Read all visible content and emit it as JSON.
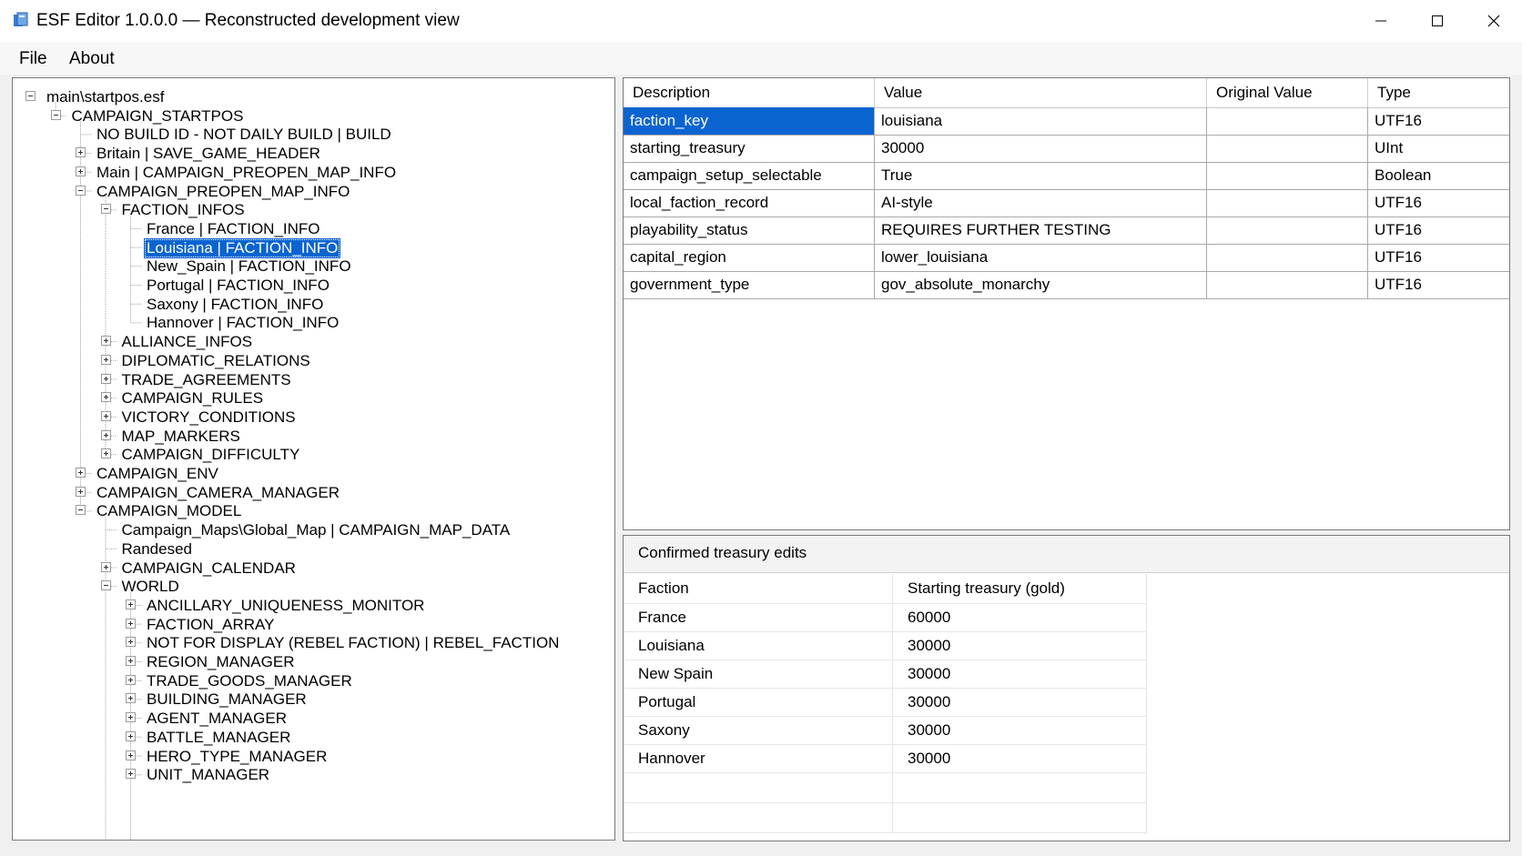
{
  "window": {
    "title": "ESF Editor 1.0.0.0 — Reconstructed development view",
    "controls": {
      "minimize": "minimize-icon",
      "maximize": "maximize-icon",
      "close": "close-icon"
    }
  },
  "menu": {
    "file": "File",
    "about": "About"
  },
  "tree": {
    "nodes": [
      {
        "label": "main\\startpos.esf",
        "level": 0,
        "state": "expanded"
      },
      {
        "label": "CAMPAIGN_STARTPOS",
        "level": 1,
        "state": "expanded"
      },
      {
        "label": "NO BUILD ID - NOT DAILY BUILD | BUILD",
        "level": 2,
        "state": "leaf"
      },
      {
        "label": "Britain | SAVE_GAME_HEADER",
        "level": 2,
        "state": "collapsed"
      },
      {
        "label": "Main | CAMPAIGN_PREOPEN_MAP_INFO",
        "level": 2,
        "state": "collapsed"
      },
      {
        "label": "CAMPAIGN_PREOPEN_MAP_INFO",
        "level": 2,
        "state": "expanded"
      },
      {
        "label": "FACTION_INFOS",
        "level": 3,
        "state": "expanded"
      },
      {
        "label": "France | FACTION_INFO",
        "level": 4,
        "state": "leaf"
      },
      {
        "label": "Louisiana | FACTION_INFO",
        "level": 4,
        "state": "leaf",
        "selected": true
      },
      {
        "label": "New_Spain | FACTION_INFO",
        "level": 4,
        "state": "leaf"
      },
      {
        "label": "Portugal | FACTION_INFO",
        "level": 4,
        "state": "leaf"
      },
      {
        "label": "Saxony | FACTION_INFO",
        "level": 4,
        "state": "leaf"
      },
      {
        "label": "Hannover | FACTION_INFO",
        "level": 4,
        "state": "leaf"
      },
      {
        "label": "ALLIANCE_INFOS",
        "level": 3,
        "state": "collapsed"
      },
      {
        "label": "DIPLOMATIC_RELATIONS",
        "level": 3,
        "state": "collapsed"
      },
      {
        "label": "TRADE_AGREEMENTS",
        "level": 3,
        "state": "collapsed"
      },
      {
        "label": "CAMPAIGN_RULES",
        "level": 3,
        "state": "collapsed"
      },
      {
        "label": "VICTORY_CONDITIONS",
        "level": 3,
        "state": "collapsed"
      },
      {
        "label": "MAP_MARKERS",
        "level": 3,
        "state": "collapsed"
      },
      {
        "label": "CAMPAIGN_DIFFICULTY",
        "level": 3,
        "state": "collapsed"
      },
      {
        "label": "CAMPAIGN_ENV",
        "level": 2,
        "state": "collapsed"
      },
      {
        "label": "CAMPAIGN_CAMERA_MANAGER",
        "level": 2,
        "state": "collapsed"
      },
      {
        "label": "CAMPAIGN_MODEL",
        "level": 2,
        "state": "expanded"
      },
      {
        "label": "Campaign_Maps\\Global_Map | CAMPAIGN_MAP_DATA",
        "level": 3,
        "state": "leaf"
      },
      {
        "label": "Randesed",
        "level": 3,
        "state": "leaf"
      },
      {
        "label": "CAMPAIGN_CALENDAR",
        "level": 3,
        "state": "collapsed"
      },
      {
        "label": "WORLD",
        "level": 3,
        "state": "expanded"
      },
      {
        "label": "ANCILLARY_UNIQUENESS_MONITOR",
        "level": 4,
        "state": "collapsed"
      },
      {
        "label": "FACTION_ARRAY",
        "level": 4,
        "state": "collapsed"
      },
      {
        "label": "NOT FOR DISPLAY (REBEL FACTION) | REBEL_FACTION",
        "level": 4,
        "state": "collapsed"
      },
      {
        "label": "REGION_MANAGER",
        "level": 4,
        "state": "collapsed"
      },
      {
        "label": "TRADE_GOODS_MANAGER",
        "level": 4,
        "state": "collapsed"
      },
      {
        "label": "BUILDING_MANAGER",
        "level": 4,
        "state": "collapsed"
      },
      {
        "label": "AGENT_MANAGER",
        "level": 4,
        "state": "collapsed"
      },
      {
        "label": "BATTLE_MANAGER",
        "level": 4,
        "state": "collapsed"
      },
      {
        "label": "HERO_TYPE_MANAGER",
        "level": 4,
        "state": "collapsed"
      },
      {
        "label": "UNIT_MANAGER",
        "level": 4,
        "state": "collapsed"
      }
    ]
  },
  "grid": {
    "headers": {
      "description": "Description",
      "value": "Value",
      "original_value": "Original Value",
      "type": "Type"
    },
    "rows": [
      {
        "description": "faction_key",
        "value": "louisiana",
        "original_value": "",
        "type": "UTF16",
        "selected": true
      },
      {
        "description": "starting_treasury",
        "value": "30000",
        "original_value": "",
        "type": "UInt"
      },
      {
        "description": "campaign_setup_selectable",
        "value": "True",
        "original_value": "",
        "type": "Boolean"
      },
      {
        "description": "local_faction_record",
        "value": "AI-style",
        "original_value": "",
        "type": "UTF16"
      },
      {
        "description": "playability_status",
        "value": "REQUIRES FURTHER TESTING",
        "original_value": "",
        "type": "UTF16"
      },
      {
        "description": "capital_region",
        "value": "lower_louisiana",
        "original_value": "",
        "type": "UTF16"
      },
      {
        "description": "government_type",
        "value": "gov_absolute_monarchy",
        "original_value": "",
        "type": "UTF16"
      }
    ]
  },
  "treasury": {
    "caption": "Confirmed treasury edits",
    "headers": {
      "faction": "Faction",
      "gold": "Starting treasury (gold)"
    },
    "rows": [
      {
        "faction": "France",
        "gold": "60000"
      },
      {
        "faction": "Louisiana",
        "gold": "30000"
      },
      {
        "faction": "New Spain",
        "gold": "30000"
      },
      {
        "faction": "Portugal",
        "gold": "30000"
      },
      {
        "faction": "Saxony",
        "gold": "30000"
      },
      {
        "faction": "Hannover",
        "gold": "30000"
      }
    ]
  },
  "colors": {
    "selection": "#0a64d0",
    "window_bg": "#f0f0f0",
    "panel_bg": "#ffffff"
  }
}
